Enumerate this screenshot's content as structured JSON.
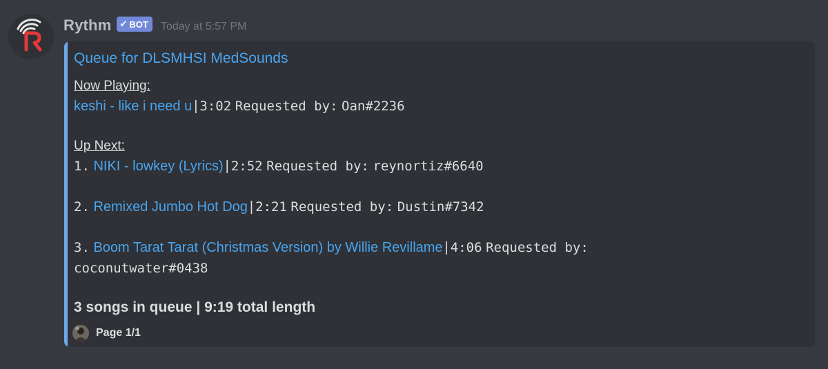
{
  "message": {
    "author": "Rythm",
    "bot_tag": "BOT",
    "timestamp": "Today at 5:57 PM"
  },
  "embed": {
    "title": "Queue for DLSMHSI MedSounds",
    "now_playing_label": "Now Playing:",
    "now_playing": {
      "title": "keshi - like i need u",
      "duration": "3:02",
      "requested_label": "Requested by:",
      "requester": "Oan#2236"
    },
    "up_next_label": "Up Next:",
    "queue": [
      {
        "index": "1.",
        "title": "NIKI - lowkey (Lyrics)",
        "duration": "2:52",
        "requested_label": "Requested by:",
        "requester": "reynortiz#6640"
      },
      {
        "index": "2.",
        "title": "Remixed Jumbo Hot Dog",
        "duration": "2:21",
        "requested_label": "Requested by:",
        "requester": "Dustin#7342"
      },
      {
        "index": "3.",
        "title": "Boom Tarat Tarat (Christmas Version) by Willie Revillame",
        "duration": "4:06",
        "requested_label": "Requested by:",
        "requester": "coconutwater#0438"
      }
    ],
    "summary": "3 songs in queue | 9:19 total length",
    "footer": "Page 1/1"
  },
  "colors": {
    "background": "#36393f",
    "embed_background": "#2f3136",
    "embed_accent": "#6fa8e8",
    "link": "#48a5f0",
    "bot_tag": "#7289da",
    "brand_red": "#e03a3a"
  },
  "icons": {
    "avatar": "rythm-logo-icon",
    "check": "check-icon",
    "footer_avatar": "user-avatar-icon"
  }
}
